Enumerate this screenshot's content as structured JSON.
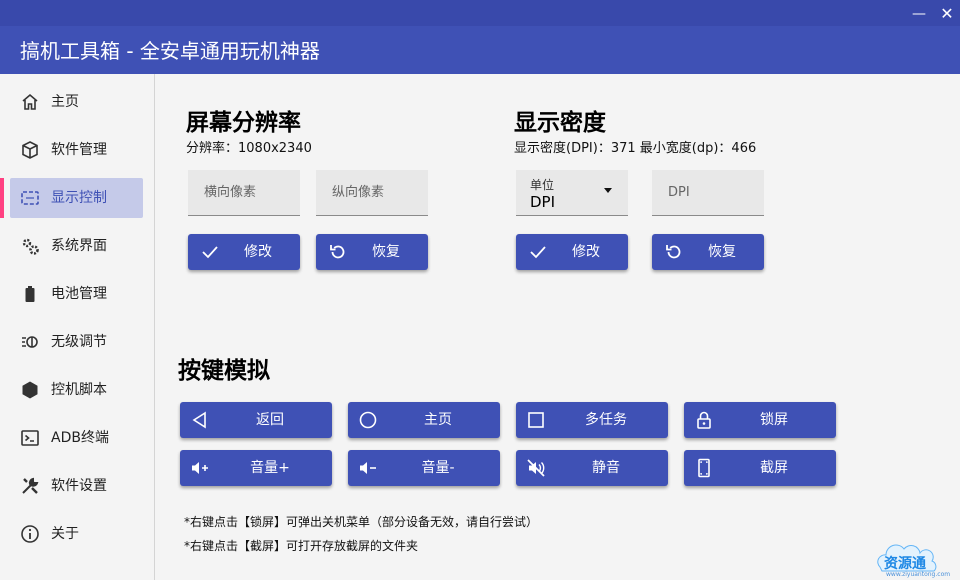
{
  "window": {
    "title": "搞机工具箱 - 全安卓通用玩机神器",
    "minimize": "—",
    "close": "✕"
  },
  "sidebar": {
    "items": [
      {
        "label": "主页",
        "icon": "home-icon"
      },
      {
        "label": "软件管理",
        "icon": "package-icon"
      },
      {
        "label": "显示控制",
        "icon": "display-icon",
        "active": true
      },
      {
        "label": "系统界面",
        "icon": "gears-icon"
      },
      {
        "label": "电池管理",
        "icon": "battery-icon"
      },
      {
        "label": "无级调节",
        "icon": "adjust-icon"
      },
      {
        "label": "控机脚本",
        "icon": "hexagon-icon"
      },
      {
        "label": "ADB终端",
        "icon": "terminal-icon"
      },
      {
        "label": "软件设置",
        "icon": "tools-icon"
      },
      {
        "label": "关于",
        "icon": "info-icon"
      }
    ]
  },
  "resolution": {
    "title": "屏幕分辨率",
    "info": "分辨率：1080x2340",
    "width_placeholder": "横向像素",
    "height_placeholder": "纵向像素",
    "apply_label": "修改",
    "restore_label": "恢复"
  },
  "density": {
    "title": "显示密度",
    "info": "显示密度(DPI)：371   最小宽度(dp)：466",
    "unit_label": "单位",
    "unit_value": "DPI",
    "dpi_placeholder": "DPI",
    "apply_label": "修改",
    "restore_label": "恢复"
  },
  "keys": {
    "title": "按键模拟",
    "buttons": [
      {
        "label": "返回",
        "icon": "back-triangle-icon"
      },
      {
        "label": "主页",
        "icon": "home-circle-icon"
      },
      {
        "label": "多任务",
        "icon": "square-icon"
      },
      {
        "label": "锁屏",
        "icon": "lock-icon"
      },
      {
        "label": "音量+",
        "icon": "volume-up-icon"
      },
      {
        "label": "音量-",
        "icon": "volume-down-icon"
      },
      {
        "label": "静音",
        "icon": "mute-icon"
      },
      {
        "label": "截屏",
        "icon": "screenshot-icon"
      }
    ],
    "notes": [
      "*右键点击【锁屏】可弹出关机菜单（部分设备无效，请自行尝试）",
      "*右键点击【截屏】可打开存放截屏的文件夹"
    ]
  },
  "watermark": {
    "text": "资源通",
    "url": "www.ziyuantong.com"
  },
  "colors": {
    "primary": "#3f51b5",
    "titlebar_top": "#3949ab",
    "active_bg": "#c5cae9",
    "active_bar": "#ff4081"
  }
}
